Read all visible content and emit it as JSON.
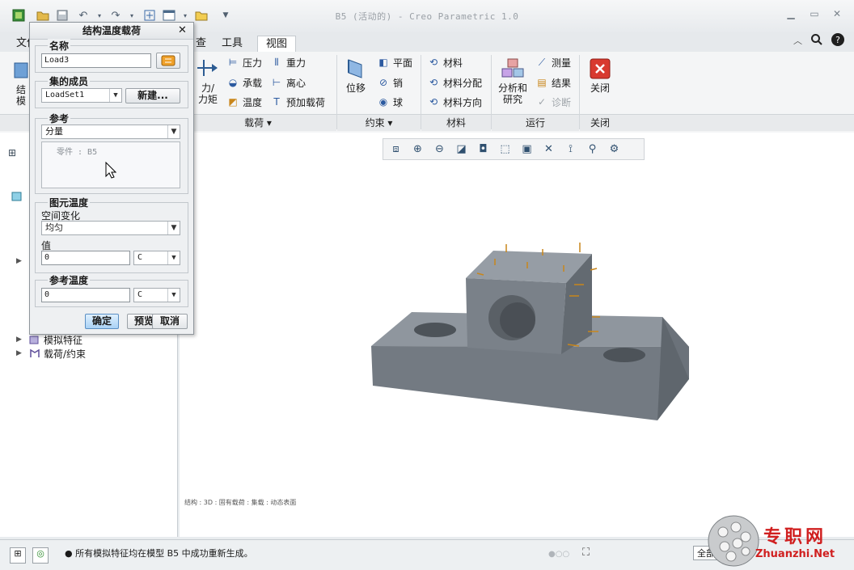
{
  "window": {
    "title": "B5 (活动的) - Creo Parametric 1.0"
  },
  "menu_tabs": [
    {
      "label": "文件"
    },
    {
      "label": "查"
    },
    {
      "label": "工具"
    },
    {
      "label": "视图"
    }
  ],
  "ribbon": {
    "left_cut_label": "结\n模",
    "force_label": "力/\n力矩",
    "load_items": [
      "压力",
      "承载",
      "温度",
      "重力",
      "离心",
      "预加载荷"
    ],
    "load_group": "载荷 ▾",
    "displacement_label": "位移",
    "constraint_items": [
      "平面",
      "销",
      "球"
    ],
    "constraint_group": "约束 ▾",
    "material_items": [
      "材料",
      "材料分配",
      "材料方向"
    ],
    "material_group": "材料",
    "analysis_label": "分析和\n研究",
    "run_items": [
      "测量",
      "结果",
      "诊断"
    ],
    "run_group": "运行",
    "close_label": "关闭",
    "close_group": "关闭"
  },
  "tree": {
    "items": [
      {
        "label": "模拟特征"
      },
      {
        "label": "载荷/约束"
      }
    ]
  },
  "dialog": {
    "title": "结构温度载荷",
    "name_legend": "名称",
    "name_value": "Load3",
    "members_legend": "集的成员",
    "loadset_value": "LoadSet1",
    "new_button": "新建...",
    "reference_legend": "参考",
    "reference_type": "分量",
    "reference_list_item": "零件 : B5",
    "element_temp_legend": "图元温度",
    "spatial_label": "空间变化",
    "spatial_value": "均匀",
    "value_label": "值",
    "value_input": "0",
    "value_unit": "C",
    "ref_temp_legend": "参考温度",
    "ref_temp_input": "0",
    "ref_temp_unit": "C",
    "ok_button": "确定",
    "preview_button": "预览",
    "cancel_button": "取消"
  },
  "graphics": {
    "footer_caption": "结构 : 3D : 固有载荷 : 集载 : 动态表面"
  },
  "status": {
    "message": "● 所有模拟特征均在模型 B5 中成功重新生成。",
    "filter_label": "全部",
    "watermark_cn": "专职网",
    "watermark_url": "Zhuanzhi.Net"
  },
  "colors": {
    "part_face_top": "#8f969e",
    "part_face_front": "#737a82",
    "part_face_side": "#5f666d",
    "load_arrow": "#c9861a",
    "close_red": "#d83a2f"
  }
}
